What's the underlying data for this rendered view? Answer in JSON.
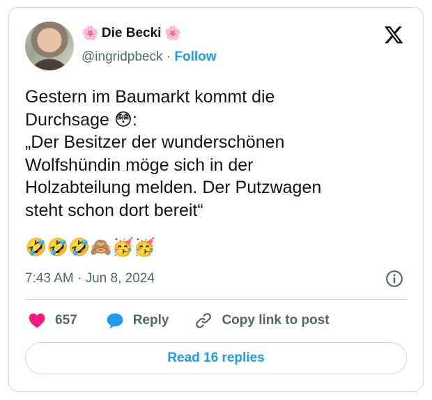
{
  "author": {
    "name": "Die Becki",
    "name_emoji_left": "🌸",
    "name_emoji_right": "🌸",
    "handle": "@ingridpbeck",
    "separator": "·",
    "follow_label": "Follow"
  },
  "tweet": {
    "text": "Gestern im Baumarkt kommt die\nDurchsage 😳:\n„Der Besitzer der wunderschönen\nWolfshündin möge sich in der\nHolzabteilung melden. Der Putzwagen\nsteht schon dort bereit“",
    "emoji_line": "🤣🤣🤣🙈🥳🥳",
    "time": "7:43 AM",
    "date_separator": "·",
    "date": "Jun 8, 2024"
  },
  "actions": {
    "likes_count": "657",
    "reply_label": "Reply",
    "copy_link_label": "Copy link to post"
  },
  "read_replies_label": "Read 16 replies",
  "icons": {
    "logo": "x-logo-icon",
    "info": "info-icon",
    "like": "heart-icon",
    "reply": "speech-bubble-icon",
    "copy": "link-icon"
  },
  "colors": {
    "accent": "#1d9bf0",
    "like": "#f91880",
    "secondary_text": "#536471",
    "border": "#cfd9de"
  }
}
